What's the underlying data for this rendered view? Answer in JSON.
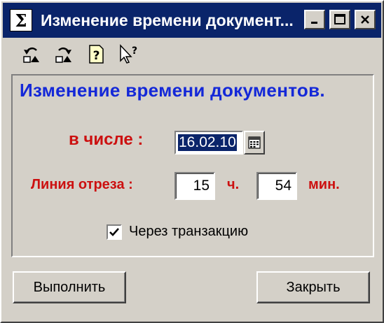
{
  "window": {
    "title": "Изменение времени документ...",
    "app_icon_glyph": "Σ"
  },
  "titlebar_buttons": {
    "minimize_icon": "minimize-icon",
    "maximize_icon": "maximize-icon",
    "close_icon": "close-icon"
  },
  "toolbar": [
    {
      "icon": "undo-icon"
    },
    {
      "icon": "redo-icon"
    },
    {
      "icon": "help-icon"
    },
    {
      "icon": "whats-this-icon"
    }
  ],
  "heading": "Изменение времени документов.",
  "date_row": {
    "label": "в числе :",
    "value": "16.02.10"
  },
  "cutoff_row": {
    "label": "Линия отреза :",
    "hours": "15",
    "hours_unit": "ч.",
    "minutes": "54",
    "minutes_unit": "мин."
  },
  "transaction": {
    "label": "Через транзакцию",
    "checked": true
  },
  "buttons": {
    "execute": "Выполнить",
    "close": "Закрыть"
  },
  "colors": {
    "titlebar": "#0a246a",
    "heading": "#1428d8",
    "label_red": "#cc1010",
    "face": "#d4d0c8"
  }
}
